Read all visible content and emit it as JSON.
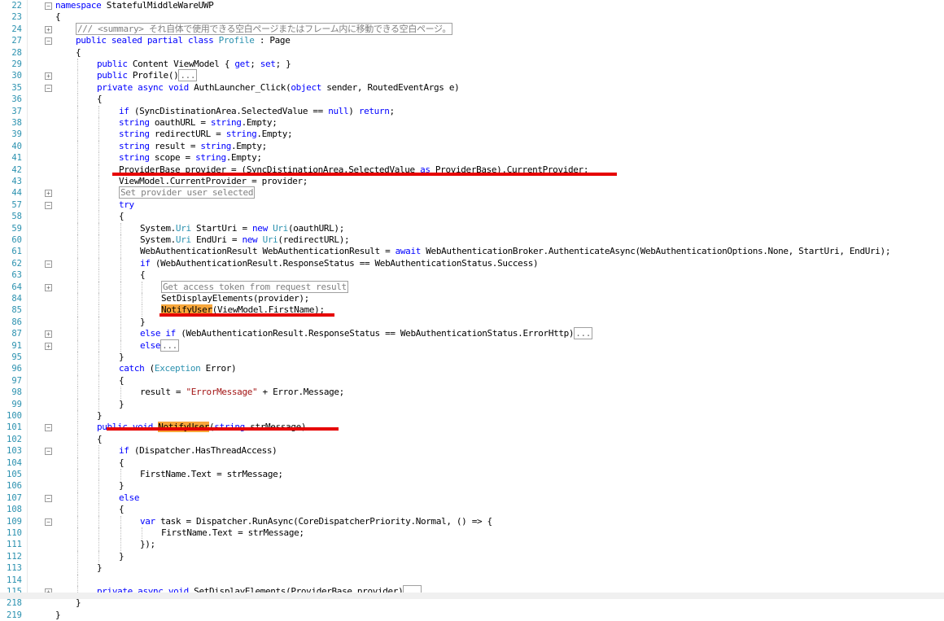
{
  "editor": {
    "lines": [
      {
        "n": "22",
        "fold": "minus",
        "indent": 0,
        "segs": [
          [
            "kw",
            "namespace"
          ],
          [
            "",
            " StatefulMiddleWareUWP"
          ]
        ]
      },
      {
        "n": "23",
        "fold": "",
        "indent": 0,
        "segs": [
          [
            "",
            "{"
          ]
        ]
      },
      {
        "n": "24",
        "fold": "plus",
        "indent": 1,
        "segs": [
          [
            "box-sum",
            "/// <summary> それ自体で使用できる空白ページまたはフレーム内に移動できる空白ページ。"
          ]
        ]
      },
      {
        "n": "27",
        "fold": "minus",
        "indent": 1,
        "segs": [
          [
            "kw",
            "public sealed partial class"
          ],
          [
            "",
            " "
          ],
          [
            "ty",
            "Profile"
          ],
          [
            "",
            " : Page"
          ]
        ]
      },
      {
        "n": "28",
        "fold": "",
        "indent": 1,
        "segs": [
          [
            "",
            "{"
          ]
        ]
      },
      {
        "n": "29",
        "fold": "",
        "indent": 2,
        "segs": [
          [
            "kw",
            "public"
          ],
          [
            "",
            " Content ViewModel { "
          ],
          [
            "kw",
            "get"
          ],
          [
            "",
            "; "
          ],
          [
            "kw",
            "set"
          ],
          [
            "",
            "; }"
          ]
        ]
      },
      {
        "n": "30",
        "fold": "plus",
        "indent": 2,
        "segs": [
          [
            "kw",
            "public"
          ],
          [
            "",
            " Profile()"
          ],
          [
            "dots",
            "..."
          ]
        ]
      },
      {
        "n": "35",
        "fold": "minus",
        "indent": 2,
        "segs": [
          [
            "kw",
            "private async void"
          ],
          [
            "",
            " AuthLauncher_Click("
          ],
          [
            "kw",
            "object"
          ],
          [
            "",
            " sender, RoutedEventArgs e)"
          ]
        ]
      },
      {
        "n": "36",
        "fold": "",
        "indent": 2,
        "segs": [
          [
            "",
            "{"
          ]
        ]
      },
      {
        "n": "37",
        "fold": "",
        "indent": 3,
        "segs": [
          [
            "kw",
            "if"
          ],
          [
            "",
            " (SyncDistinationArea.SelectedValue == "
          ],
          [
            "kw",
            "null"
          ],
          [
            "",
            ") "
          ],
          [
            "kw",
            "return"
          ],
          [
            "",
            ";"
          ]
        ]
      },
      {
        "n": "38",
        "fold": "",
        "indent": 3,
        "segs": [
          [
            "kw",
            "string"
          ],
          [
            "",
            " oauthURL = "
          ],
          [
            "kw",
            "string"
          ],
          [
            "",
            ".Empty;"
          ]
        ]
      },
      {
        "n": "39",
        "fold": "",
        "indent": 3,
        "segs": [
          [
            "kw",
            "string"
          ],
          [
            "",
            " redirectURL = "
          ],
          [
            "kw",
            "string"
          ],
          [
            "",
            ".Empty;"
          ]
        ]
      },
      {
        "n": "40",
        "fold": "",
        "indent": 3,
        "segs": [
          [
            "kw",
            "string"
          ],
          [
            "",
            " result = "
          ],
          [
            "kw",
            "string"
          ],
          [
            "",
            ".Empty;"
          ]
        ]
      },
      {
        "n": "41",
        "fold": "",
        "indent": 3,
        "segs": [
          [
            "kw",
            "string"
          ],
          [
            "",
            " scope = "
          ],
          [
            "kw",
            "string"
          ],
          [
            "",
            ".Empty;"
          ]
        ]
      },
      {
        "n": "42",
        "fold": "",
        "indent": 3,
        "segs": [
          [
            "",
            "ProviderBase provider = (SyncDistinationArea.SelectedValue "
          ],
          [
            "kw",
            "as"
          ],
          [
            "",
            " ProviderBase).CurrentProvider;"
          ]
        ]
      },
      {
        "n": "43",
        "fold": "",
        "indent": 3,
        "segs": [
          [
            "",
            "ViewModel.CurrentProvider = provider;"
          ]
        ]
      },
      {
        "n": "44",
        "fold": "plus",
        "indent": 3,
        "segs": [
          [
            "box",
            "Set provider user selected"
          ]
        ]
      },
      {
        "n": "57",
        "fold": "minus",
        "indent": 3,
        "segs": [
          [
            "kw",
            "try"
          ]
        ]
      },
      {
        "n": "58",
        "fold": "",
        "indent": 3,
        "segs": [
          [
            "",
            "{"
          ]
        ]
      },
      {
        "n": "59",
        "fold": "",
        "indent": 4,
        "segs": [
          [
            "",
            "System."
          ],
          [
            "ty",
            "Uri"
          ],
          [
            "",
            " StartUri = "
          ],
          [
            "kw",
            "new"
          ],
          [
            "",
            " "
          ],
          [
            "ty",
            "Uri"
          ],
          [
            "",
            "(oauthURL);"
          ]
        ]
      },
      {
        "n": "60",
        "fold": "",
        "indent": 4,
        "segs": [
          [
            "",
            "System."
          ],
          [
            "ty",
            "Uri"
          ],
          [
            "",
            " EndUri = "
          ],
          [
            "kw",
            "new"
          ],
          [
            "",
            " "
          ],
          [
            "ty",
            "Uri"
          ],
          [
            "",
            "(redirectURL);"
          ]
        ]
      },
      {
        "n": "61",
        "fold": "",
        "indent": 4,
        "segs": [
          [
            "",
            "WebAuthenticationResult WebAuthenticationResult = "
          ],
          [
            "kw",
            "await"
          ],
          [
            "",
            " WebAuthenticationBroker.AuthenticateAsync(WebAuthenticationOptions.None, StartUri, EndUri);"
          ]
        ]
      },
      {
        "n": "62",
        "fold": "minus",
        "indent": 4,
        "segs": [
          [
            "kw",
            "if"
          ],
          [
            "",
            " (WebAuthenticationResult.ResponseStatus == WebAuthenticationStatus.Success)"
          ]
        ]
      },
      {
        "n": "63",
        "fold": "",
        "indent": 4,
        "segs": [
          [
            "",
            "{"
          ]
        ]
      },
      {
        "n": "64",
        "fold": "plus",
        "indent": 5,
        "segs": [
          [
            "box",
            "Get access token from request result"
          ]
        ]
      },
      {
        "n": "84",
        "fold": "",
        "indent": 5,
        "segs": [
          [
            "",
            "SetDisplayElements(provider);"
          ]
        ]
      },
      {
        "n": "85",
        "fold": "",
        "indent": 5,
        "segs": [
          [
            "hl",
            "NotifyUser"
          ],
          [
            "",
            "(ViewModel.FirstName);"
          ]
        ]
      },
      {
        "n": "86",
        "fold": "",
        "indent": 4,
        "segs": [
          [
            "",
            "}"
          ]
        ]
      },
      {
        "n": "87",
        "fold": "plus",
        "indent": 4,
        "segs": [
          [
            "kw",
            "else if"
          ],
          [
            "",
            " (WebAuthenticationResult.ResponseStatus == WebAuthenticationStatus.ErrorHttp)"
          ],
          [
            "dots",
            "..."
          ]
        ]
      },
      {
        "n": "91",
        "fold": "plus",
        "indent": 4,
        "segs": [
          [
            "kw",
            "else"
          ],
          [
            "dots",
            "..."
          ]
        ]
      },
      {
        "n": "95",
        "fold": "",
        "indent": 3,
        "segs": [
          [
            "",
            "}"
          ]
        ]
      },
      {
        "n": "96",
        "fold": "",
        "indent": 3,
        "segs": [
          [
            "kw",
            "catch"
          ],
          [
            "",
            " ("
          ],
          [
            "ty",
            "Exception"
          ],
          [
            "",
            " Error)"
          ]
        ]
      },
      {
        "n": "97",
        "fold": "",
        "indent": 3,
        "segs": [
          [
            "",
            "{"
          ]
        ]
      },
      {
        "n": "98",
        "fold": "",
        "indent": 4,
        "segs": [
          [
            "",
            "result = "
          ],
          [
            "str",
            "\"ErrorMessage\""
          ],
          [
            "",
            " + Error.Message;"
          ]
        ]
      },
      {
        "n": "99",
        "fold": "",
        "indent": 3,
        "segs": [
          [
            "",
            "}"
          ]
        ]
      },
      {
        "n": "100",
        "fold": "",
        "indent": 2,
        "segs": [
          [
            "",
            "}"
          ]
        ]
      },
      {
        "n": "101",
        "fold": "minus",
        "indent": 2,
        "segs": [
          [
            "kw",
            "public void"
          ],
          [
            "",
            " "
          ],
          [
            "hl",
            "NotifyUser"
          ],
          [
            "",
            "("
          ],
          [
            "kw",
            "string"
          ],
          [
            "",
            " strMessage)"
          ]
        ]
      },
      {
        "n": "102",
        "fold": "",
        "indent": 2,
        "segs": [
          [
            "",
            "{"
          ]
        ]
      },
      {
        "n": "103",
        "fold": "minus",
        "indent": 3,
        "segs": [
          [
            "kw",
            "if"
          ],
          [
            "",
            " (Dispatcher.HasThreadAccess)"
          ]
        ]
      },
      {
        "n": "104",
        "fold": "",
        "indent": 3,
        "segs": [
          [
            "",
            "{"
          ]
        ]
      },
      {
        "n": "105",
        "fold": "",
        "indent": 4,
        "segs": [
          [
            "",
            "FirstName.Text = strMessage;"
          ]
        ]
      },
      {
        "n": "106",
        "fold": "",
        "indent": 3,
        "segs": [
          [
            "",
            "}"
          ]
        ]
      },
      {
        "n": "107",
        "fold": "minus",
        "indent": 3,
        "segs": [
          [
            "kw",
            "else"
          ]
        ]
      },
      {
        "n": "108",
        "fold": "",
        "indent": 3,
        "segs": [
          [
            "",
            "{"
          ]
        ]
      },
      {
        "n": "109",
        "fold": "minus",
        "indent": 4,
        "segs": [
          [
            "kw",
            "var"
          ],
          [
            "",
            " task = Dispatcher.RunAsync(CoreDispatcherPriority.Normal, () => {"
          ]
        ]
      },
      {
        "n": "110",
        "fold": "",
        "indent": 5,
        "segs": [
          [
            "",
            "FirstName.Text = strMessage;"
          ]
        ]
      },
      {
        "n": "111",
        "fold": "",
        "indent": 4,
        "segs": [
          [
            "",
            "});"
          ]
        ]
      },
      {
        "n": "112",
        "fold": "",
        "indent": 3,
        "segs": [
          [
            "",
            "}"
          ]
        ]
      },
      {
        "n": "113",
        "fold": "",
        "indent": 2,
        "segs": [
          [
            "",
            "}"
          ]
        ]
      },
      {
        "n": "114",
        "fold": "",
        "indent": 2,
        "segs": [
          [
            "",
            ""
          ]
        ]
      },
      {
        "n": "115",
        "fold": "plus",
        "indent": 2,
        "segs": [
          [
            "kw",
            "private async void"
          ],
          [
            "",
            " SetDisplayElements(ProviderBase provider)"
          ],
          [
            "dots",
            "..."
          ]
        ]
      },
      {
        "n": "218",
        "fold": "",
        "indent": 1,
        "segs": [
          [
            "",
            "}"
          ]
        ]
      },
      {
        "n": "219",
        "fold": "",
        "indent": 0,
        "segs": [
          [
            "",
            "}"
          ]
        ]
      }
    ],
    "colors": {
      "keyword": "#0000ff",
      "type": "#2b91af",
      "highlight": "#f7a63a",
      "annotation": "#e60000"
    }
  }
}
